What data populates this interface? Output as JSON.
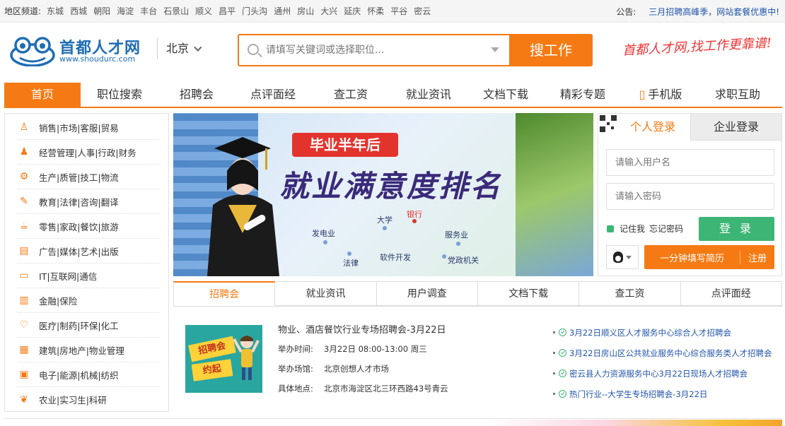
{
  "topbar": {
    "region_label": "地区频道:",
    "districts": [
      "东城",
      "西城",
      "朝阳",
      "海淀",
      "丰台",
      "石景山",
      "顺义",
      "昌平",
      "门头沟",
      "通州",
      "房山",
      "大兴",
      "延庆",
      "怀柔",
      "平谷",
      "密云"
    ],
    "notice_label": "公告:",
    "notice_text": "三月招聘高峰季，网站套餐优惠中!"
  },
  "header": {
    "logo_cn": "首都人才网",
    "logo_en": "www.shoudurc.com",
    "city": "北京",
    "search_placeholder": "请填写关键词或选择职位...",
    "search_button": "搜工作",
    "slogan": "首都人才网,找工作更靠谱!"
  },
  "nav": {
    "items": [
      "首页",
      "职位搜索",
      "招聘会",
      "点评面经",
      "查工资",
      "就业资讯",
      "文档下载",
      "精彩专题",
      "手机版",
      "求职互助"
    ]
  },
  "categories": [
    "销售|市场|客服|贸易",
    "经营管理|人事|行政|财务",
    "生产|质管|技工|物流",
    "教育|法律|咨询|翻译",
    "零售|家政|餐饮|旅游",
    "广告|媒体|艺术|出版",
    "IT|互联网|通信",
    "金融|保险",
    "医疗|制药|环保|化工",
    "建筑|房地产|物业管理",
    "电子|能源|机械|纺织",
    "农业|实习生|科研"
  ],
  "banner": {
    "ribbon": "毕业半年后",
    "headline": "就业满意度排名",
    "tags": [
      "发电业",
      "大学",
      "银行",
      "服务业",
      "法律",
      "软件开发",
      "党政机关"
    ]
  },
  "login": {
    "tab_personal": "个人登录",
    "tab_company": "企业登录",
    "username_placeholder": "请输入用户名",
    "password_placeholder": "请输入密码",
    "remember": "记住我",
    "forgot": "忘记密码",
    "login_button": "登 录",
    "resume_button": "一分钟填写简历",
    "register_button": "注册"
  },
  "content_tabs": [
    "招聘会",
    "就业资讯",
    "用户调查",
    "文档下载",
    "查工资",
    "点评面经"
  ],
  "fair": {
    "image_text_1": "招聘会",
    "image_text_2": "约起",
    "title": "物业、酒店餐饮行业专场招聘会-3月22日",
    "time_label": "举办时间:",
    "time_value": "3月22日  08:00-13:00 周三",
    "venue_label": "举办场馆:",
    "venue_value": "北京创想人才市场",
    "address_label": "具体地点:",
    "address_value": "北京市海淀区北三环西路43号青云"
  },
  "fair_links": [
    "3月22日顺义区人才服务中心综合人才招聘会",
    "3月22日房山区公共就业服务中心综合服务类人才招聘会",
    "密云县人力资源服务中心3月22日现场人才招聘会",
    "热门行业--大学生专场招聘会-3月22日"
  ],
  "colors": {
    "accent": "#f57a14",
    "brand_blue": "#1f6db5",
    "green": "#3cb575",
    "link": "#2255aa"
  }
}
